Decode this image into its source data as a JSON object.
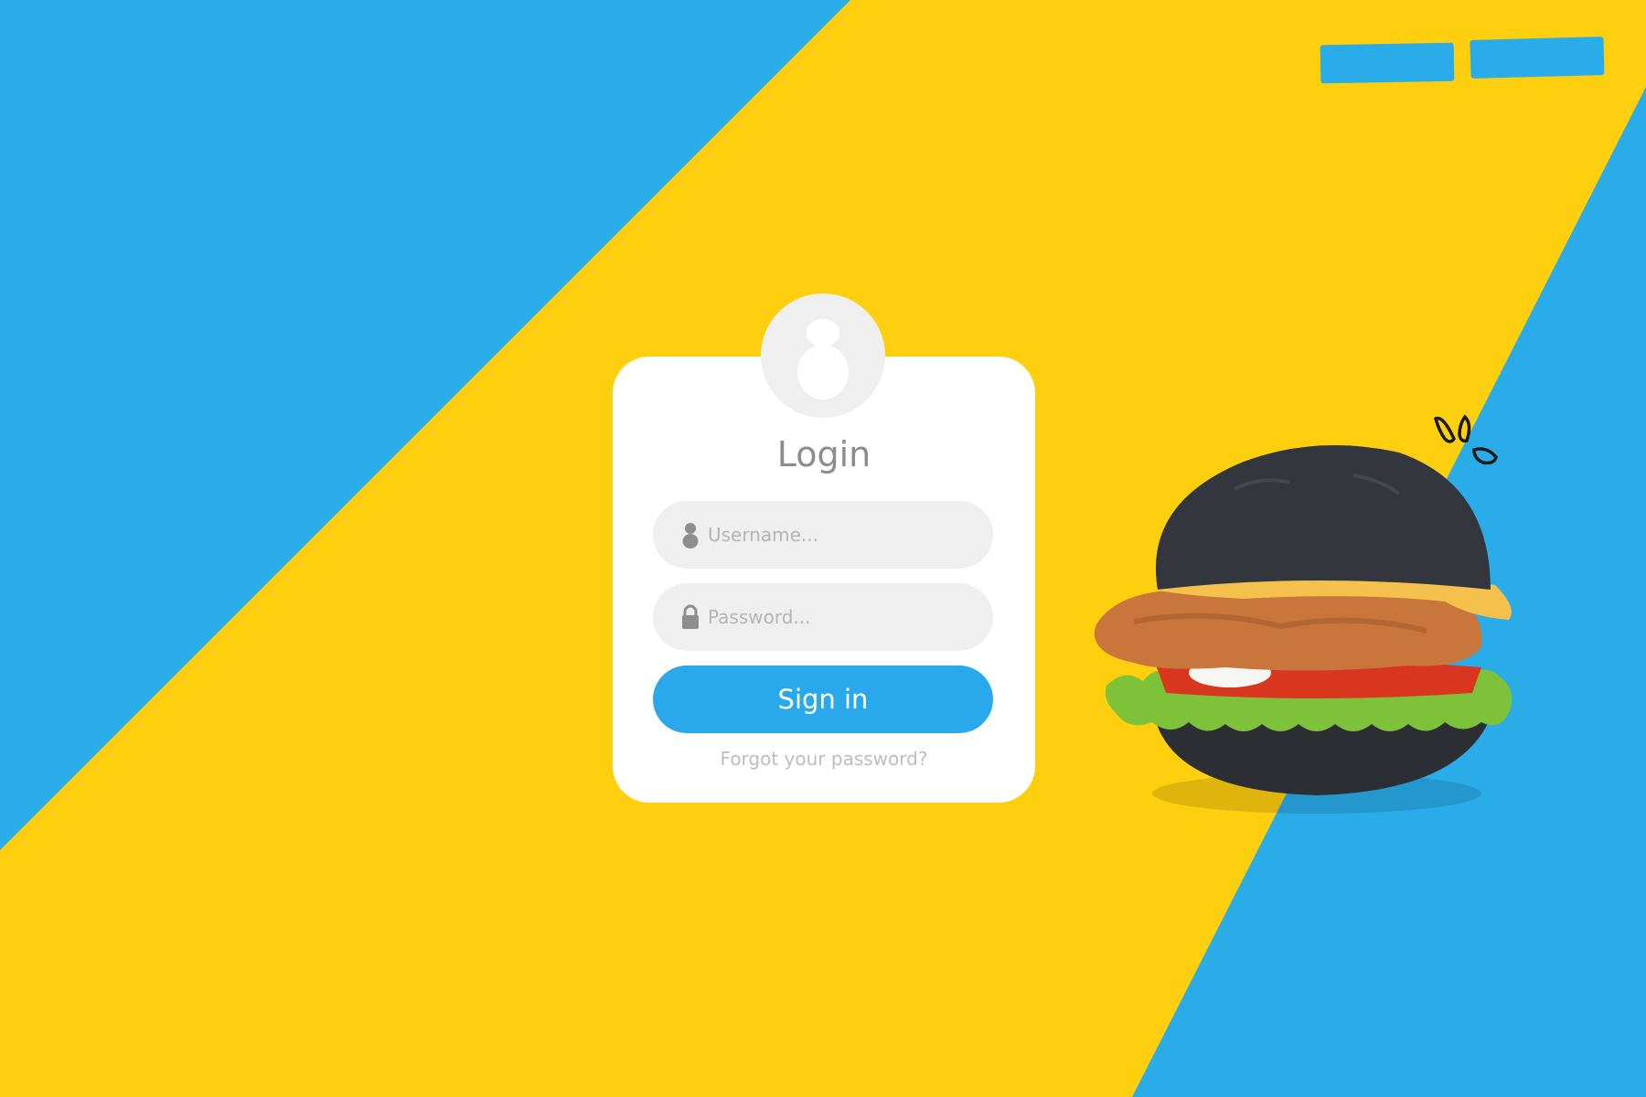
{
  "login": {
    "title": "Login",
    "username_placeholder": "Username...",
    "password_placeholder": "Password...",
    "signin_label": "Sign in",
    "forgot_label": "Forgot your password?"
  },
  "icons": {
    "avatar": "user-avatar-icon",
    "username": "user-icon",
    "password": "lock-icon"
  },
  "colors": {
    "blue": "#2AACE9",
    "yellow": "#FECF0F",
    "button": "#29A9EC",
    "card": "#FFFFFF",
    "field": "#EFEFEF"
  }
}
